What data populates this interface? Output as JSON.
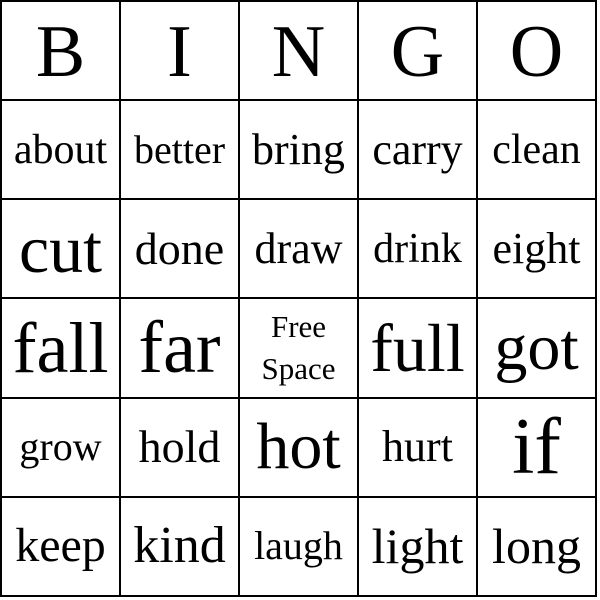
{
  "card": {
    "title_letters": [
      "B",
      "I",
      "N",
      "G",
      "O"
    ],
    "rows": [
      [
        "about",
        "better",
        "bring",
        "carry",
        "clean"
      ],
      [
        "cut",
        "done",
        "draw",
        "drink",
        "eight"
      ],
      [
        "fall",
        "far",
        "Free Space",
        "full",
        "got"
      ],
      [
        "grow",
        "hold",
        "hot",
        "hurt",
        "if"
      ],
      [
        "keep",
        "kind",
        "laugh",
        "light",
        "long"
      ]
    ],
    "free_space": {
      "line1": "Free",
      "line2": "Space"
    }
  }
}
